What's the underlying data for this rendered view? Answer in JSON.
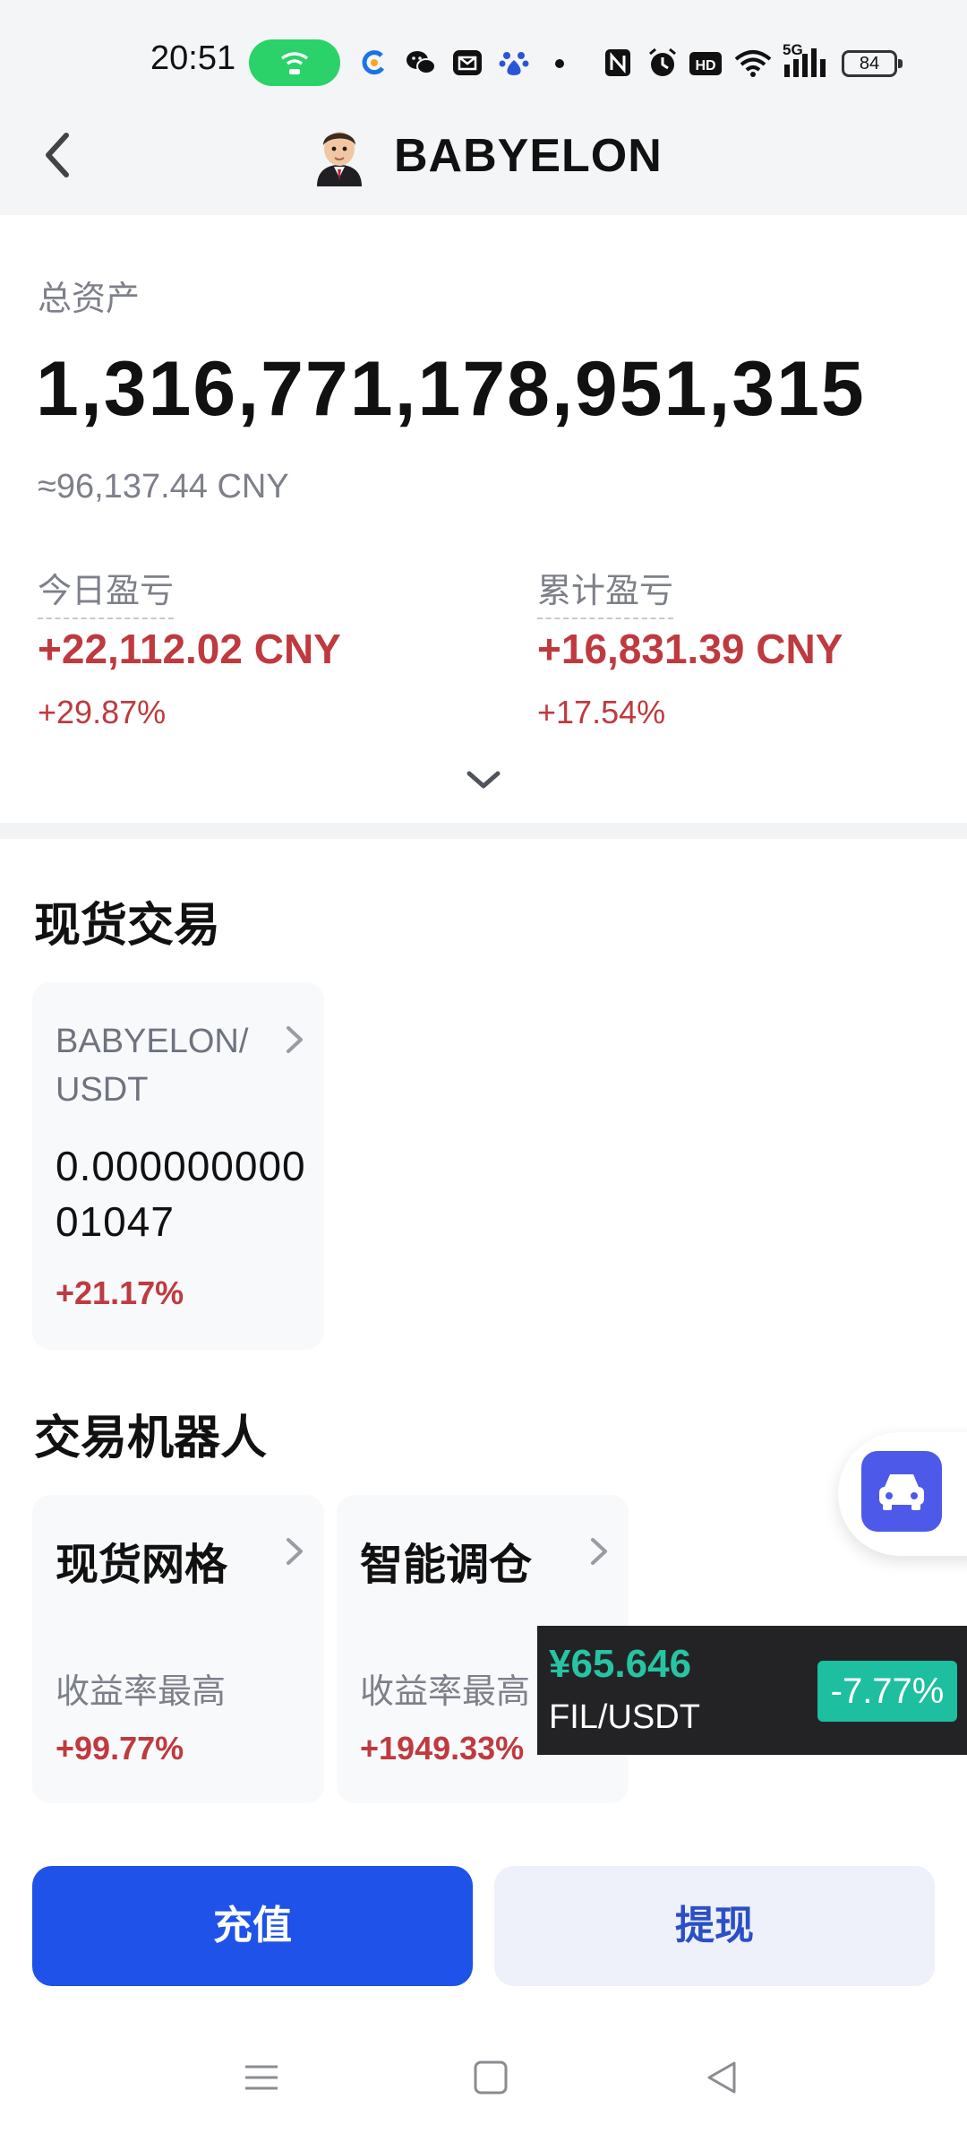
{
  "status_bar": {
    "time": "20:51",
    "network": "5G",
    "battery": "84",
    "icons": [
      "hotspot-icon",
      "browser-icon",
      "wechat-icon",
      "mail-icon",
      "baidu-icon",
      "nfc-icon",
      "alarm-icon",
      "hd-icon",
      "wifi-icon",
      "signal-icon",
      "battery-icon"
    ]
  },
  "header": {
    "title": "BABYELON",
    "back_icon": "chevron-left-icon",
    "avatar_icon": "avatar-icon"
  },
  "assets": {
    "total_label": "总资产",
    "total_value": "1,316,771,178,951,315",
    "approx_cny": "≈96,137.44 CNY",
    "today_label": "今日盈亏",
    "today_value": "+22,112.02 CNY",
    "today_pct": "+29.87%",
    "cumulative_label": "累计盈亏",
    "cumulative_value": "+16,831.39 CNY",
    "cumulative_pct": "+17.54%"
  },
  "spot": {
    "title": "现货交易",
    "card": {
      "pair_line1": "BABYELON/",
      "pair_line2": "USDT",
      "price_line1": "0.000000000",
      "price_line2": "01047",
      "change": "+21.17%"
    }
  },
  "bots": {
    "title": "交易机器人",
    "items": [
      {
        "name": "现货网格",
        "sub": "收益率最高",
        "value": "+99.77%"
      },
      {
        "name": "智能调仓",
        "sub": "收益率最高",
        "value": "+1949.33%"
      }
    ]
  },
  "ticker": {
    "price": "¥65.646",
    "pair": "FIL/USDT",
    "change": "-7.77%"
  },
  "actions": {
    "deposit": "充值",
    "withdraw": "提现"
  },
  "colors": {
    "primary": "#1e52e8",
    "profit_red": "#bf3a3f",
    "ticker_green": "#1ebea0",
    "float_blue": "#4d59e8"
  }
}
